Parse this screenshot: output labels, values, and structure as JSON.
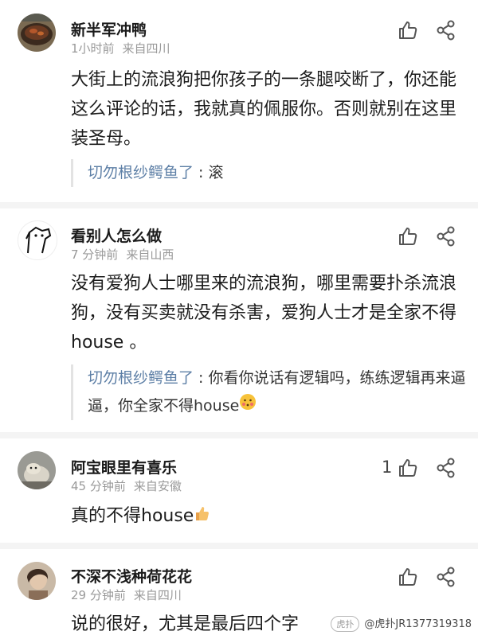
{
  "comments": [
    {
      "username": "新半军冲鸭",
      "time": "1小时前",
      "location": "来自四川",
      "text": "大街上的流浪狗把你孩子的一条腿咬断了，你还能这么评论的话，我就真的佩服你。否则就别在这里装圣母。",
      "reply": {
        "name": "切勿根纱鳄鱼了",
        "text": " : 滚"
      }
    },
    {
      "username": "看别人怎么做",
      "time": "7 分钟前",
      "location": "来自山西",
      "text": "没有爱狗人士哪里来的流浪狗，哪里需要扑杀流浪狗，没有买卖就没有杀害，爱狗人士才是全家不得 house 。",
      "reply": {
        "name": "切勿根纱鳄鱼了",
        "text": " : 你看你说话有逻辑吗，练练逻辑再来逼逼，你全家不得house"
      }
    },
    {
      "username": "阿宝眼里有喜乐",
      "time": "45 分钟前",
      "location": "来自安徽",
      "text": "真的不得house",
      "like_count": "1"
    },
    {
      "username": "不深不浅种荷花花",
      "time": "29 分钟前",
      "location": "来自四川",
      "text": "说的很好，尤其是最后四个字"
    }
  ],
  "icons": {
    "like": "thumbs-up-icon",
    "share": "share-icon"
  },
  "colors": {
    "reply_name": "#5d7fa6",
    "meta": "#9a9a9a"
  },
  "watermark": {
    "logo": "虎扑",
    "text": "@虎扑JR1377319318"
  }
}
